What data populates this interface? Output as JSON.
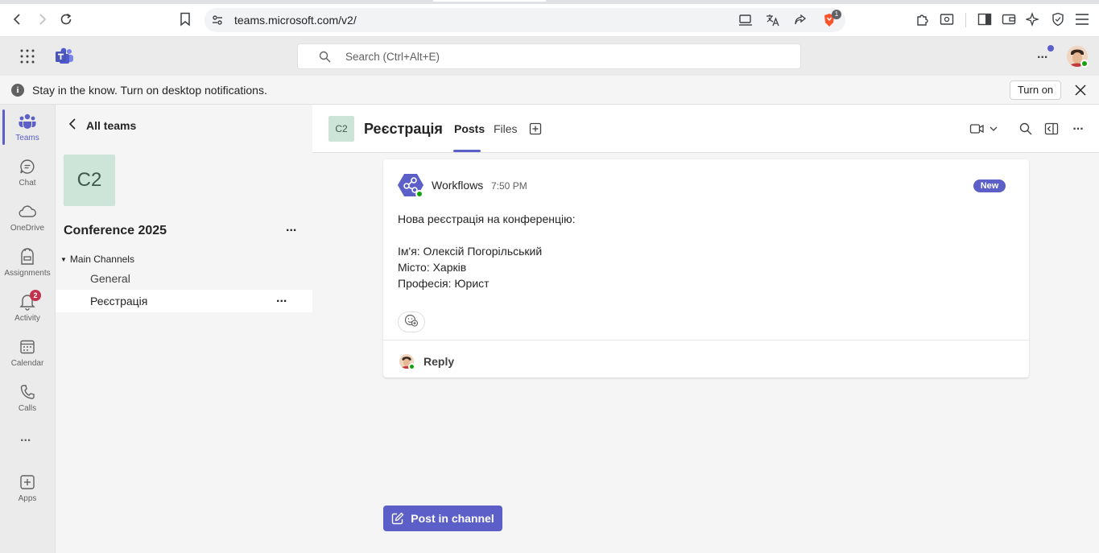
{
  "browser": {
    "url": "teams.microsoft.com/v2/",
    "brave_badge_count": "1"
  },
  "topbar": {
    "search_placeholder": "Search (Ctrl+Alt+E)",
    "more_label": "..."
  },
  "banner": {
    "text": "Stay in the know. Turn on desktop notifications.",
    "turn_on_label": "Turn on"
  },
  "rail": {
    "items": [
      {
        "label": "Teams",
        "icon": "teams-icon",
        "active": true
      },
      {
        "label": "Chat",
        "icon": "chat-icon"
      },
      {
        "label": "OneDrive",
        "icon": "onedrive-icon"
      },
      {
        "label": "Assignments",
        "icon": "assignments-icon"
      },
      {
        "label": "Activity",
        "icon": "bell-icon",
        "badge": "2"
      },
      {
        "label": "Calendar",
        "icon": "calendar-icon"
      },
      {
        "label": "Calls",
        "icon": "phone-icon"
      },
      {
        "label": "Apps",
        "icon": "add-apps-icon"
      }
    ],
    "more_label": "..."
  },
  "channels": {
    "back_label": "All teams",
    "team_initials": "C2",
    "team_name": "Conference 2025",
    "section_label": "Main Channels",
    "items": [
      {
        "label": "General"
      },
      {
        "label": "Реєстрація",
        "selected": true
      }
    ],
    "more_label": "..."
  },
  "channel_header": {
    "tile_initials": "C2",
    "title": "Реєстрація",
    "tabs": [
      "Posts",
      "Files"
    ],
    "active_tab": "Posts",
    "more_label": "..."
  },
  "message": {
    "author": "Workflows",
    "time": "7:50 PM",
    "badge": "New",
    "lines": [
      "Нова реєстрація на конференцію:",
      "Ім'я: Олексій Погорільський",
      "Місто: Харків",
      "Професія: Юрист"
    ],
    "reply_label": "Reply"
  },
  "compose": {
    "post_label": "Post in channel"
  },
  "colors": {
    "accent": "#5b5fc7",
    "team_tile": "#cde4d8",
    "presence": "#13a10e",
    "badge": "#c4314b"
  }
}
